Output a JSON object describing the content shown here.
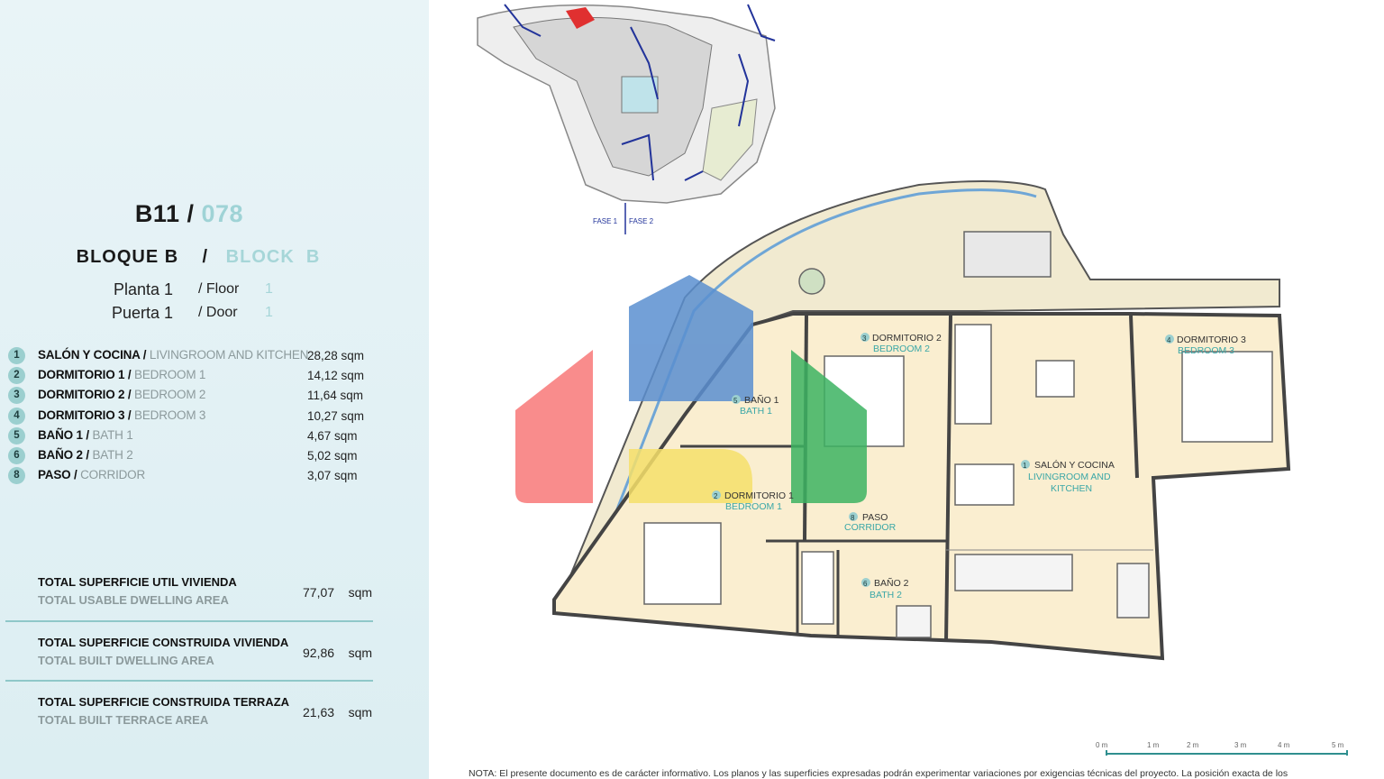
{
  "unit": {
    "code": "B11",
    "code_sep": "/",
    "number": "078",
    "block_es": "BLOQUE B",
    "block_sep": "/",
    "block_en": "BLOCK",
    "block_en_letter": "B",
    "floor_es": "Planta 1",
    "floor_en": "/ Floor",
    "floor_en_num": "1",
    "door_es": "Puerta 1",
    "door_en": "/ Door",
    "door_en_num": "1"
  },
  "rooms": [
    {
      "num": "1",
      "es": "SALÓN Y COCINA /",
      "en": "LIVINGROOM AND KITCHEN",
      "area": "28,28 sqm"
    },
    {
      "num": "2",
      "es": "DORMITORIO 1 /",
      "en": "BEDROOM 1",
      "area": "14,12 sqm"
    },
    {
      "num": "3",
      "es": "DORMITORIO 2 /",
      "en": "BEDROOM 2",
      "area": "11,64 sqm"
    },
    {
      "num": "4",
      "es": "DORMITORIO 3 /",
      "en": "BEDROOM 3",
      "area": "10,27 sqm"
    },
    {
      "num": "5",
      "es": "BAÑO 1 /",
      "en": "BATH 1",
      "area": "4,67 sqm"
    },
    {
      "num": "6",
      "es": "BAÑO 2 /",
      "en": "BATH 2",
      "area": "5,02 sqm"
    },
    {
      "num": "8",
      "es": "PASO /",
      "en": "CORRIDOR",
      "area": "3,07 sqm"
    }
  ],
  "totals": [
    {
      "es": "TOTAL SUPERFICIE UTIL VIVIENDA",
      "en": "TOTAL USABLE DWELLING AREA",
      "value": "77,07",
      "unit": "sqm"
    },
    {
      "es": "TOTAL SUPERFICIE CONSTRUIDA VIVIENDA",
      "en": "TOTAL BUILT DWELLING AREA",
      "value": "92,86",
      "unit": "sqm"
    },
    {
      "es": "TOTAL SUPERFICIE CONSTRUIDA TERRAZA",
      "en": "TOTAL BUILT TERRACE AREA",
      "value": "21,63",
      "unit": "sqm"
    }
  ],
  "site_plan": {
    "phase1": "FASE 1",
    "phase2": "FASE 2"
  },
  "plan_labels": {
    "bath1_num": "5",
    "bath1_es": "BAÑO 1",
    "bath1_en": "BATH 1",
    "bed1_num": "2",
    "bed1_es": "DORMITORIO 1",
    "bed1_en": "BEDROOM 1",
    "bed2_num": "3",
    "bed2_es": "DORMITORIO 2",
    "bed2_en": "BEDROOM 2",
    "bed3_num": "4",
    "bed3_es": "DORMITORIO 3",
    "bed3_en": "BEDROOM 3",
    "living_num": "1",
    "living_es": "SALÓN Y COCINA",
    "living_en1": "LIVINGROOM AND",
    "living_en2": "KITCHEN",
    "corr_num": "8",
    "corr_es": "PASO",
    "corr_en": "CORRIDOR",
    "bath2_num": "6",
    "bath2_es": "BAÑO 2",
    "bath2_en": "BATH 2"
  },
  "scale": [
    "0 m",
    "1 m",
    "2 m",
    "3 m",
    "4 m",
    "5 m"
  ],
  "note": "NOTA: El presente documento es de carácter informativo. Los planos y las superficies expresadas podrán experimentar variaciones por exigencias técnicas del proyecto. La posición exacta de los",
  "colors": {
    "accent_teal": "#9fd3d6",
    "room_fill": "#faeed0",
    "wall": "#555555",
    "window_blue": "#6fa6d6"
  }
}
